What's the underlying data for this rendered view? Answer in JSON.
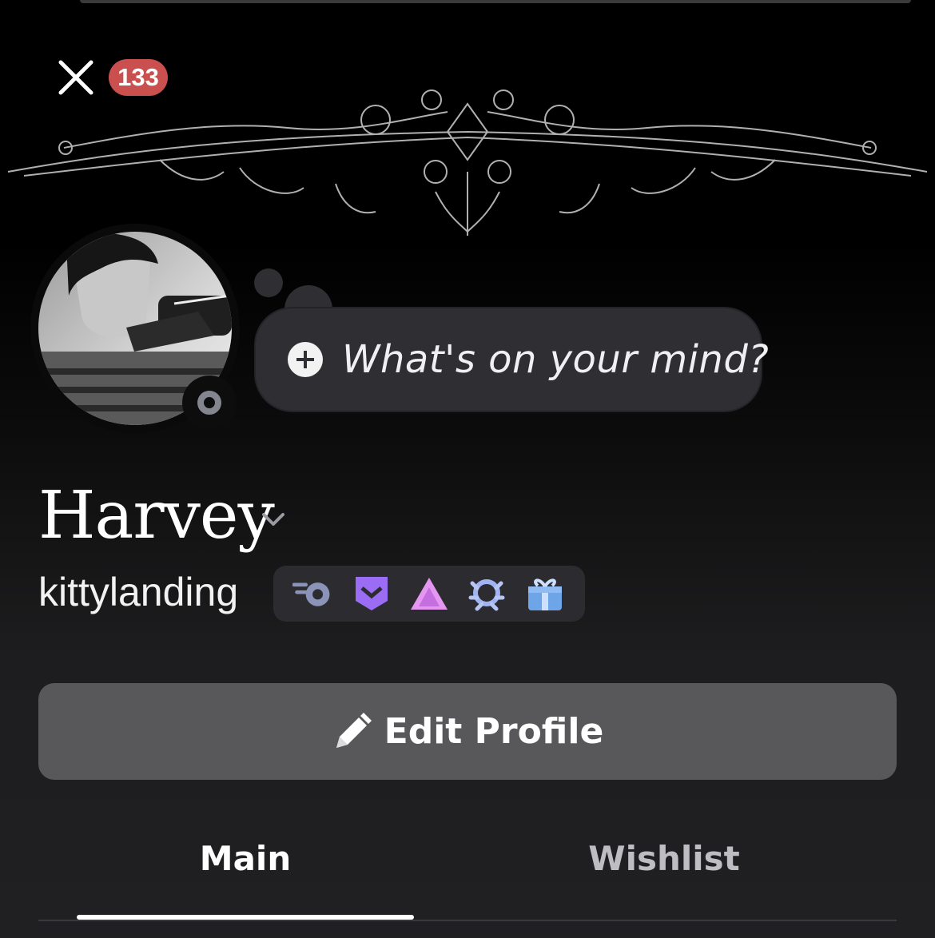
{
  "header": {
    "notification_count": "133"
  },
  "status_bubble": {
    "placeholder": "What's on your mind?"
  },
  "profile": {
    "display_name": "Harvey",
    "username": "kittylanding",
    "badges": [
      "nitro-badge-icon",
      "hypesquad-badge-icon",
      "boost-badge-icon",
      "quest-badge-icon",
      "gift-badge-icon"
    ]
  },
  "actions": {
    "edit_profile": "Edit Profile"
  },
  "tabs": [
    {
      "label": "Main",
      "selected": true
    },
    {
      "label": "Wishlist",
      "selected": false
    }
  ],
  "colors": {
    "badge_red": "#c9504f",
    "button_gray": "#58585b",
    "bubble": "#2e2e33"
  }
}
